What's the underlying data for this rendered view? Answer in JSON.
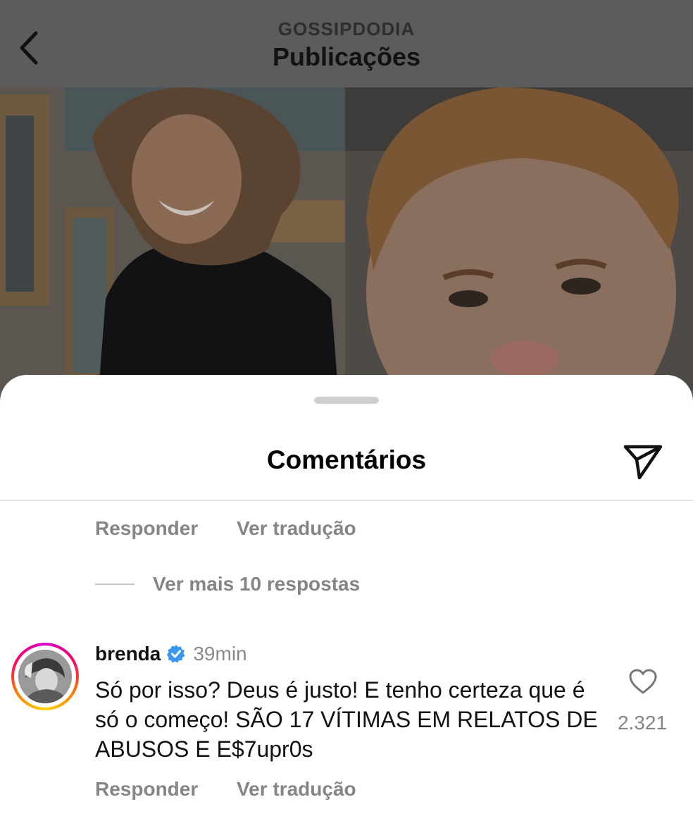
{
  "header": {
    "account": "GOSSIPDODIA",
    "title": "Publicações",
    "back_icon": "chevron-left-icon"
  },
  "sheet": {
    "title": "Comentários",
    "share_icon": "send-icon"
  },
  "previous_comment_actions": {
    "reply_label": "Responder",
    "translate_label": "Ver tradução"
  },
  "more_replies": "Ver mais 10 respostas",
  "comment": {
    "username": "brenda",
    "verified": true,
    "time": "39min",
    "text": "Só por isso? Deus é justo! E tenho certeza que é só o começo! SÃO 17 VÍTIMAS EM RELATOS DE ABUSOS E E$7upr0s",
    "likes": "2.321",
    "reply_label": "Responder",
    "translate_label": "Ver tradução"
  },
  "colors": {
    "verified_badge": "#3897f0",
    "muted_text": "#858585",
    "story_ring": [
      "#d300c5",
      "#ff0069",
      "#ff7a00",
      "#ffd600"
    ]
  }
}
